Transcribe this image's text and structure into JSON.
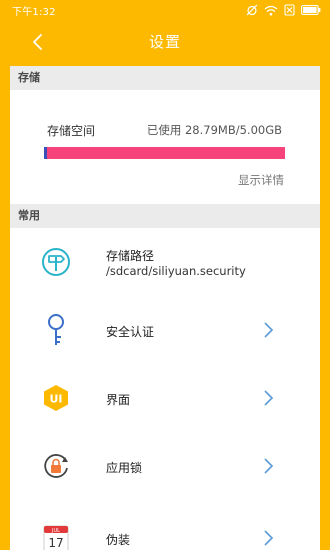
{
  "status_bar": {
    "time": "下午1:32",
    "icons": [
      "alarm-off-icon",
      "wifi-icon",
      "sim-off-icon",
      "battery-icon"
    ]
  },
  "header": {
    "title": "设置",
    "back_icon": "back-chevron-icon"
  },
  "colors": {
    "primary": "#fdb900",
    "storage_free": "#f6437b",
    "storage_used": "#3b4fb8",
    "chevron": "#5b9bd5"
  },
  "storage_section": {
    "header": "存储",
    "label": "存储空间",
    "usage_text": "已使用 28.79MB/5.00GB",
    "used_fraction": 0.0056,
    "details_link": "显示详情"
  },
  "common_section": {
    "header": "常用",
    "items": [
      {
        "icon": "signpost-icon",
        "title": "存储路径",
        "subtitle": "/sdcard/siliyuan.security",
        "has_chevron": false
      },
      {
        "icon": "key-icon",
        "title": "安全认证",
        "has_chevron": true
      },
      {
        "icon": "ui-theme-icon",
        "title": "界面",
        "has_chevron": true
      },
      {
        "icon": "app-lock-icon",
        "title": "应用锁",
        "has_chevron": true
      },
      {
        "icon": "calendar-icon",
        "title": "伪装",
        "has_chevron": true,
        "icon_month": "JUL",
        "icon_day": "17"
      }
    ]
  }
}
